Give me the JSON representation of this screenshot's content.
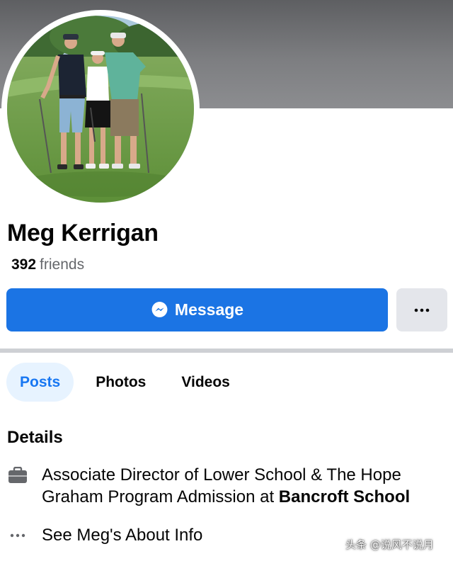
{
  "profile": {
    "name": "Meg Kerrigan",
    "friends_count": "392",
    "friends_label": "friends"
  },
  "actions": {
    "message_label": "Message",
    "message_icon": "messenger-icon",
    "more_icon": "more-dots-icon",
    "more_glyph": "···"
  },
  "tabs": [
    {
      "label": "Posts",
      "active": true
    },
    {
      "label": "Photos",
      "active": false
    },
    {
      "label": "Videos",
      "active": false
    }
  ],
  "details": {
    "title": "Details",
    "work": {
      "icon": "briefcase-icon",
      "text_before": "Associate Director of Lower School & The Hope Graham Program Admission at",
      "employer": "Bancroft School"
    },
    "about": {
      "icon": "more-dots-icon",
      "icon_glyph": "···",
      "label": "See Meg's About Info"
    }
  },
  "watermark": "头条 @说风不说月",
  "colors": {
    "accent": "#1b74e4",
    "tab_active_bg": "#e7f3ff",
    "tab_active_text": "#1877f2",
    "secondary_text": "#65676b",
    "neutral_button": "#e4e6eb"
  }
}
